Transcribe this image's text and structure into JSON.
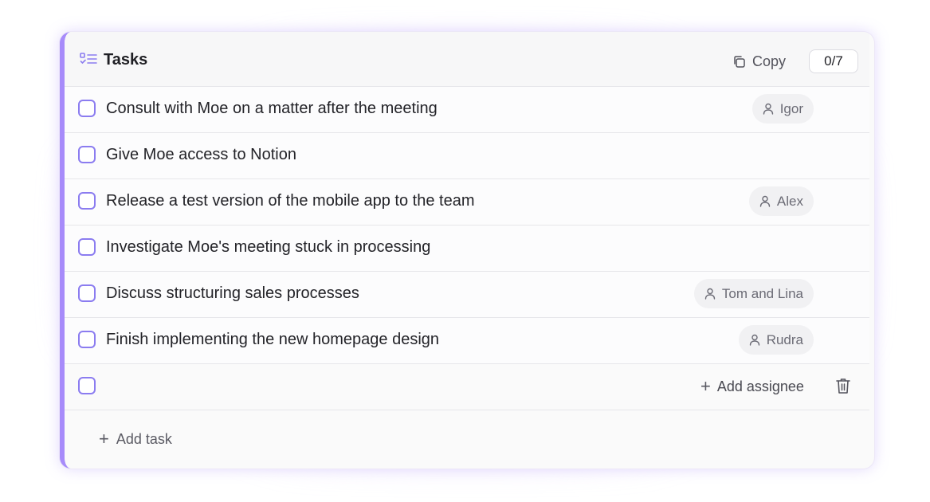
{
  "header": {
    "title": "Tasks",
    "copy_label": "Copy",
    "counter": "0/7"
  },
  "tasks": [
    {
      "text": "Consult with Moe on a matter after the meeting",
      "assignee": "Igor"
    },
    {
      "text": "Give Moe access to Notion",
      "assignee": ""
    },
    {
      "text": "Release a test version of the mobile app to the team",
      "assignee": "Alex"
    },
    {
      "text": "Investigate Moe's meeting stuck in processing",
      "assignee": ""
    },
    {
      "text": "Discuss structuring sales processes",
      "assignee": "Tom and Lina"
    },
    {
      "text": "Finish implementing the new homepage design",
      "assignee": "Rudra"
    }
  ],
  "new_task": {
    "add_assignee_label": "Add assignee"
  },
  "footer": {
    "add_task_label": "Add task"
  },
  "icons": {
    "header": "tasks-list-icon",
    "copy": "copy-icon",
    "assignee": "person-icon",
    "add": "plus-icon",
    "delete": "trash-icon"
  },
  "colors": {
    "accent": "#a78bfa",
    "checkbox_border": "#8b7cf0",
    "text": "#232328"
  }
}
